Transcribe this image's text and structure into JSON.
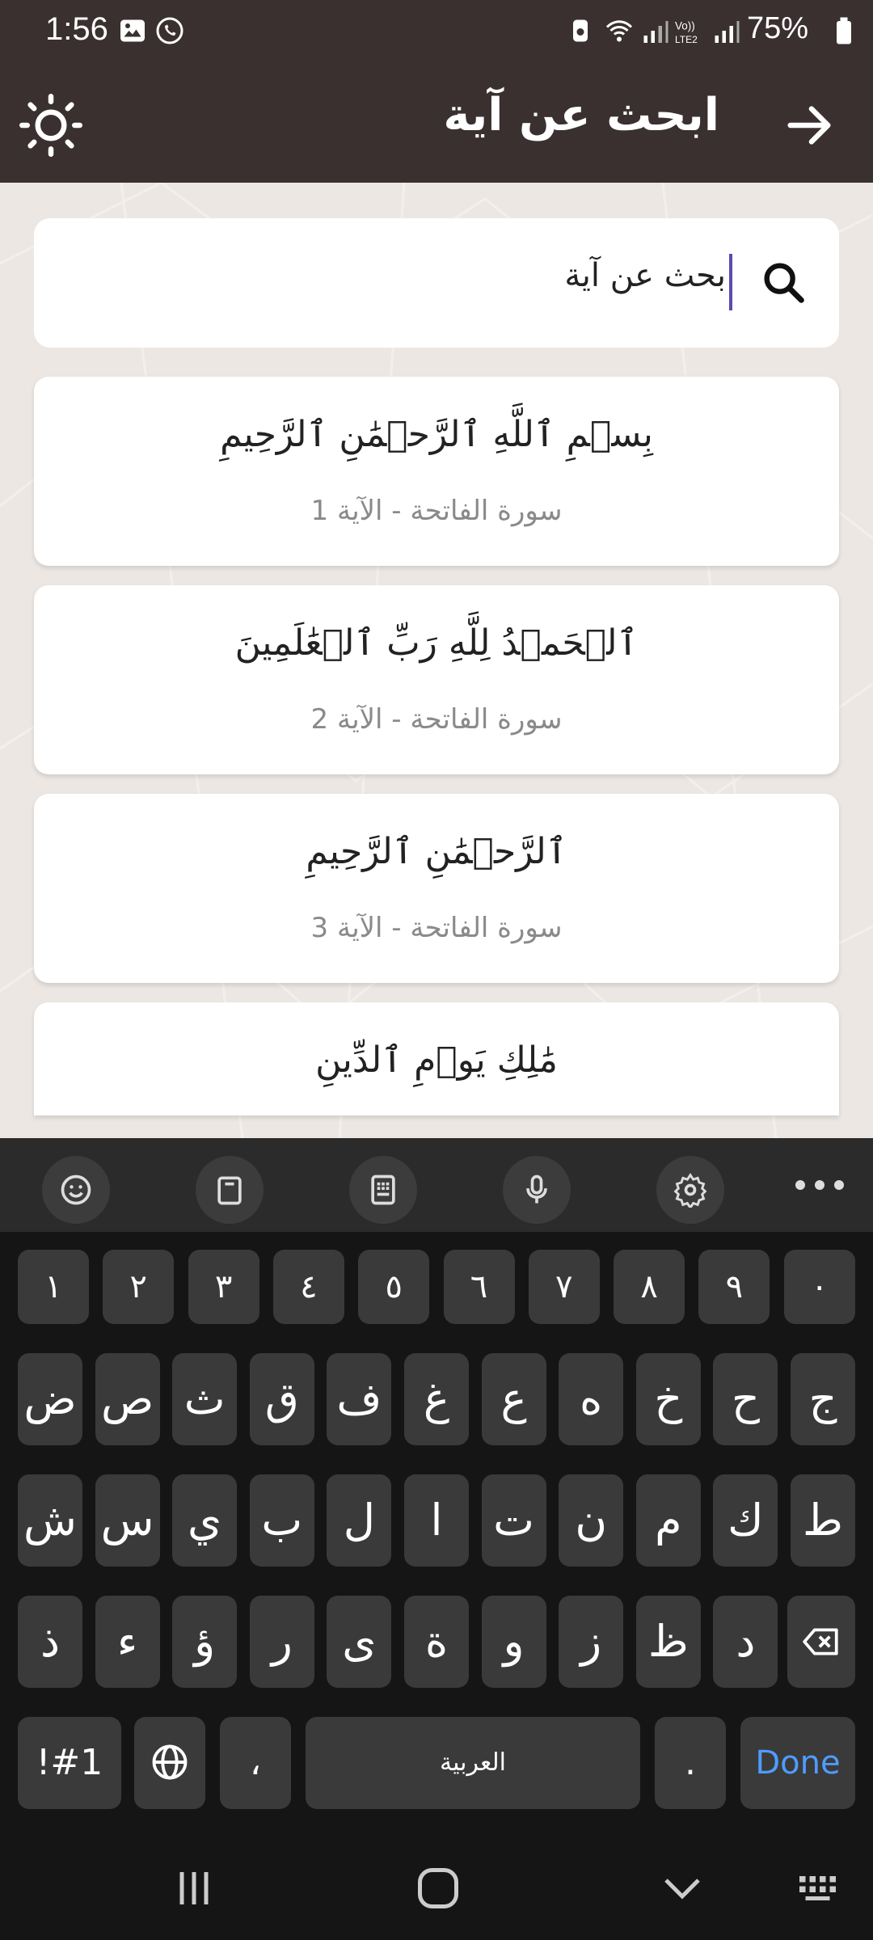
{
  "status_bar": {
    "time": "1:56",
    "battery": "75%"
  },
  "app_bar": {
    "title": "ابحث عن آية"
  },
  "search": {
    "value": "بحث عن آية"
  },
  "results": [
    {
      "ayah": "بِسۡمِ ٱللَّهِ ٱلرَّحۡمَٰنِ ٱلرَّحِيمِ",
      "ref": "سورة الفاتحة - الآية 1"
    },
    {
      "ayah": "ٱلۡحَمۡدُ لِلَّهِ رَبِّ ٱلۡعَٰلَمِينَ",
      "ref": "سورة الفاتحة - الآية 2"
    },
    {
      "ayah": "ٱلرَّحۡمَٰنِ ٱلرَّحِيمِ",
      "ref": "سورة الفاتحة - الآية 3"
    },
    {
      "ayah": "مَٰلِكِ يَوۡمِ ٱلدِّينِ",
      "ref": ""
    }
  ],
  "keyboard": {
    "numbers": [
      "١",
      "٢",
      "٣",
      "٤",
      "٥",
      "٦",
      "٧",
      "٨",
      "٩",
      "٠"
    ],
    "row1": [
      "ض",
      "ص",
      "ث",
      "ق",
      "ف",
      "غ",
      "ع",
      "ه",
      "خ",
      "ح",
      "ج"
    ],
    "row2": [
      "ش",
      "س",
      "ي",
      "ب",
      "ل",
      "ا",
      "ت",
      "ن",
      "م",
      "ك",
      "ط"
    ],
    "row3": [
      "ذ",
      "ء",
      "ؤ",
      "ر",
      "ى",
      "ة",
      "و",
      "ز",
      "ظ",
      "د"
    ],
    "symbols_label": "!#1",
    "comma": "،",
    "space_label": "العربية",
    "period": ".",
    "done_label": "Done"
  },
  "colors": {
    "app_bar": "#3a3030",
    "accent": "#4e9cff",
    "caret": "#5a4bb0"
  }
}
